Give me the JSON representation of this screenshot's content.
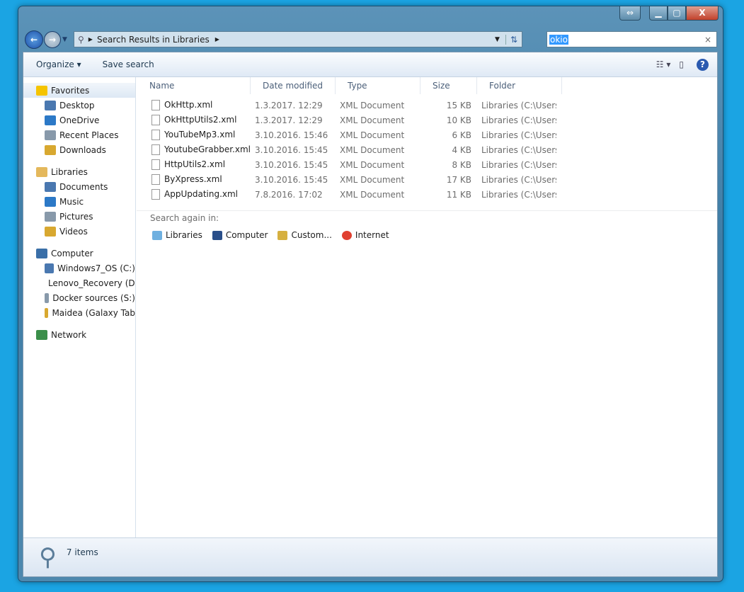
{
  "window": {
    "restore_glyph": "⇔",
    "minimize_glyph": "▁",
    "maximize_glyph": "▢",
    "close_glyph": "X"
  },
  "address": {
    "breadcrumb": "Search Results in Libraries"
  },
  "search": {
    "value": "okio",
    "clear": "×"
  },
  "toolbar": {
    "organize": "Organize ▾",
    "save_search": "Save search"
  },
  "sidebar": {
    "groups": [
      {
        "label": "Favorites",
        "items": [
          "Desktop",
          "OneDrive",
          "Recent Places",
          "Downloads"
        ]
      },
      {
        "label": "Libraries",
        "items": [
          "Documents",
          "Music",
          "Pictures",
          "Videos"
        ]
      },
      {
        "label": "Computer",
        "items": [
          "Windows7_OS (C:)",
          "Lenovo_Recovery (D:)",
          "Docker sources (S:)",
          "Maidea (Galaxy Tab"
        ]
      },
      {
        "label": "Network",
        "items": []
      }
    ]
  },
  "columns": [
    "Name",
    "Date modified",
    "Type",
    "Size",
    "Folder"
  ],
  "files": [
    {
      "name": "OkHttp.xml",
      "date": "1.3.2017. 12:29",
      "type": "XML Document",
      "size": "15 KB",
      "folder": "Libraries (C:\\Users..."
    },
    {
      "name": "OkHttpUtils2.xml",
      "date": "1.3.2017. 12:29",
      "type": "XML Document",
      "size": "10 KB",
      "folder": "Libraries (C:\\Users..."
    },
    {
      "name": "YouTubeMp3.xml",
      "date": "3.10.2016. 15:46",
      "type": "XML Document",
      "size": "6 KB",
      "folder": "Libraries (C:\\Users..."
    },
    {
      "name": "YoutubeGrabber.xml",
      "date": "3.10.2016. 15:45",
      "type": "XML Document",
      "size": "4 KB",
      "folder": "Libraries (C:\\Users..."
    },
    {
      "name": "HttpUtils2.xml",
      "date": "3.10.2016. 15:45",
      "type": "XML Document",
      "size": "8 KB",
      "folder": "Libraries (C:\\Users..."
    },
    {
      "name": "ByXpress.xml",
      "date": "3.10.2016. 15:45",
      "type": "XML Document",
      "size": "17 KB",
      "folder": "Libraries (C:\\Users..."
    },
    {
      "name": "AppUpdating.xml",
      "date": "7.8.2016. 17:02",
      "type": "XML Document",
      "size": "11 KB",
      "folder": "Libraries (C:\\Users..."
    }
  ],
  "search_again": {
    "label": "Search again in:",
    "options": [
      "Libraries",
      "Computer",
      "Custom...",
      "Internet"
    ]
  },
  "status": {
    "count": "7 items"
  }
}
